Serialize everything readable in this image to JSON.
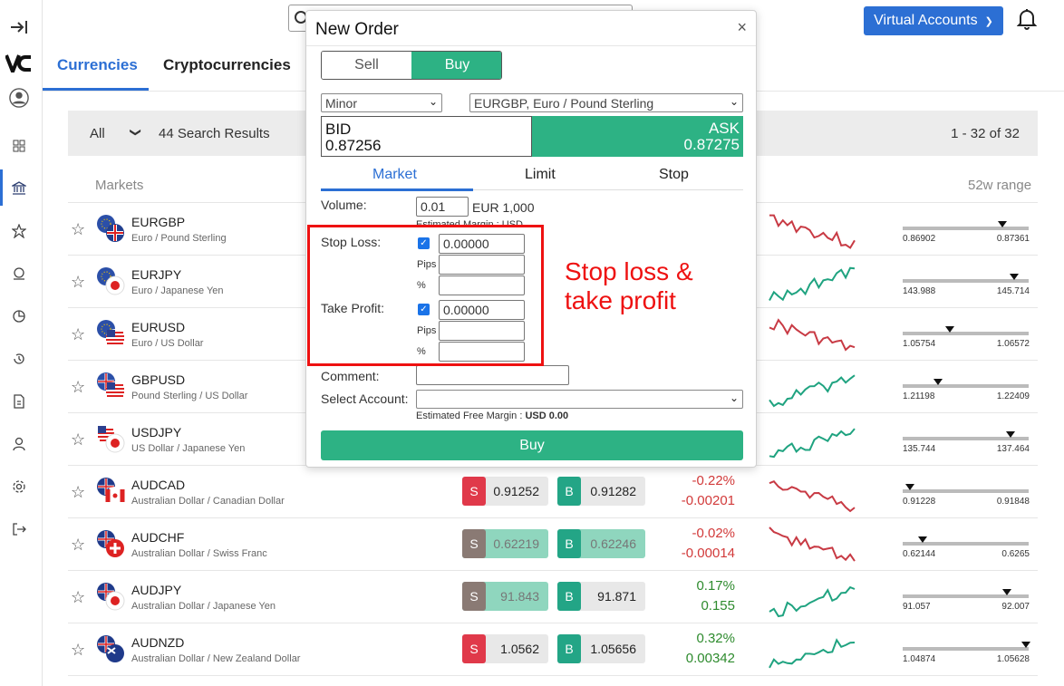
{
  "app": {
    "logo": "VC"
  },
  "header": {
    "virtual_accounts": "Virtual Accounts"
  },
  "tabs": [
    {
      "label": "Currencies"
    },
    {
      "label": "Cryptocurrencies"
    }
  ],
  "filter": {
    "value": "All",
    "results": "44 Search Results",
    "paging": "1 - 32 of 32"
  },
  "list_headers": {
    "markets": "Markets",
    "range": "52w range"
  },
  "rows": [
    {
      "sym": "EURGBP",
      "desc": "Euro / Pound Sterling",
      "trend": "down",
      "range_lo": "0.86902",
      "range_hi": "0.87361",
      "range_pos": 0.78
    },
    {
      "sym": "EURJPY",
      "desc": "Euro / Japanese Yen",
      "trend": "up",
      "range_lo": "143.988",
      "range_hi": "145.714",
      "range_pos": 0.88
    },
    {
      "sym": "EURUSD",
      "desc": "Euro / US Dollar",
      "trend": "down",
      "range_lo": "1.05754",
      "range_hi": "1.06572",
      "range_pos": 0.35
    },
    {
      "sym": "GBPUSD",
      "desc": "Pound Sterling / US Dollar",
      "trend": "up",
      "range_lo": "1.21198",
      "range_hi": "1.22409",
      "range_pos": 0.25
    },
    {
      "sym": "USDJPY",
      "desc": "US Dollar / Japanese Yen",
      "trend": "up",
      "range_lo": "135.744",
      "range_hi": "137.464",
      "range_pos": 0.85
    },
    {
      "sym": "AUDCAD",
      "desc": "Australian Dollar / Canadian Dollar",
      "sell": "0.91252",
      "buy": "0.91282",
      "sell_hl": false,
      "buy_hl": false,
      "pct": "-0.22%",
      "abs": "-0.00201",
      "dir": "neg",
      "trend": "down",
      "range_lo": "0.91228",
      "range_hi": "0.91848",
      "range_pos": 0.02
    },
    {
      "sym": "AUDCHF",
      "desc": "Australian Dollar / Swiss Franc",
      "sell": "0.62219",
      "buy": "0.62246",
      "sell_hl": true,
      "buy_hl": true,
      "pct": "-0.02%",
      "abs": "-0.00014",
      "dir": "neg",
      "trend": "down",
      "range_lo": "0.62144",
      "range_hi": "0.6265",
      "range_pos": 0.13
    },
    {
      "sym": "AUDJPY",
      "desc": "Australian Dollar / Japanese Yen",
      "sell": "91.843",
      "buy": "91.871",
      "sell_hl": true,
      "buy_hl": false,
      "pct": "0.17%",
      "abs": "0.155",
      "dir": "pos",
      "trend": "up",
      "range_lo": "91.057",
      "range_hi": "92.007",
      "range_pos": 0.82
    },
    {
      "sym": "AUDNZD",
      "desc": "Australian Dollar / New Zealand Dollar",
      "sell": "1.0562",
      "buy": "1.05656",
      "sell_hl": false,
      "buy_hl": false,
      "pct": "0.32%",
      "abs": "0.00342",
      "dir": "pos",
      "trend": "up",
      "range_lo": "1.04874",
      "range_hi": "1.05628",
      "range_pos": 0.98
    }
  ],
  "modal": {
    "title": "New Order",
    "close": "×",
    "sell": "Sell",
    "buy": "Buy",
    "category": "Minor",
    "instrument": "EURGBP, Euro / Pound Sterling",
    "bid_label": "BID",
    "bid": "0.87256",
    "ask_label": "ASK",
    "ask": "0.87275",
    "order_tabs": [
      "Market",
      "Limit",
      "Stop"
    ],
    "volume_label": "Volume:",
    "volume": "0.01",
    "volume_unit": "EUR 1,000",
    "est_margin": "Estimated Margin : USD",
    "stop_loss_label": "Stop Loss:",
    "stop_loss": "0.00000",
    "take_profit_label": "Take Profit:",
    "take_profit": "0.00000",
    "pips": "Pips",
    "pct": "%",
    "comment_label": "Comment:",
    "account_label": "Select Account:",
    "free_margin": "Estimated Free Margin : ",
    "free_margin_val": "USD 0.00",
    "buy_button": "Buy"
  },
  "annotation": {
    "line1": "Stop loss &",
    "line2": "take profit"
  }
}
